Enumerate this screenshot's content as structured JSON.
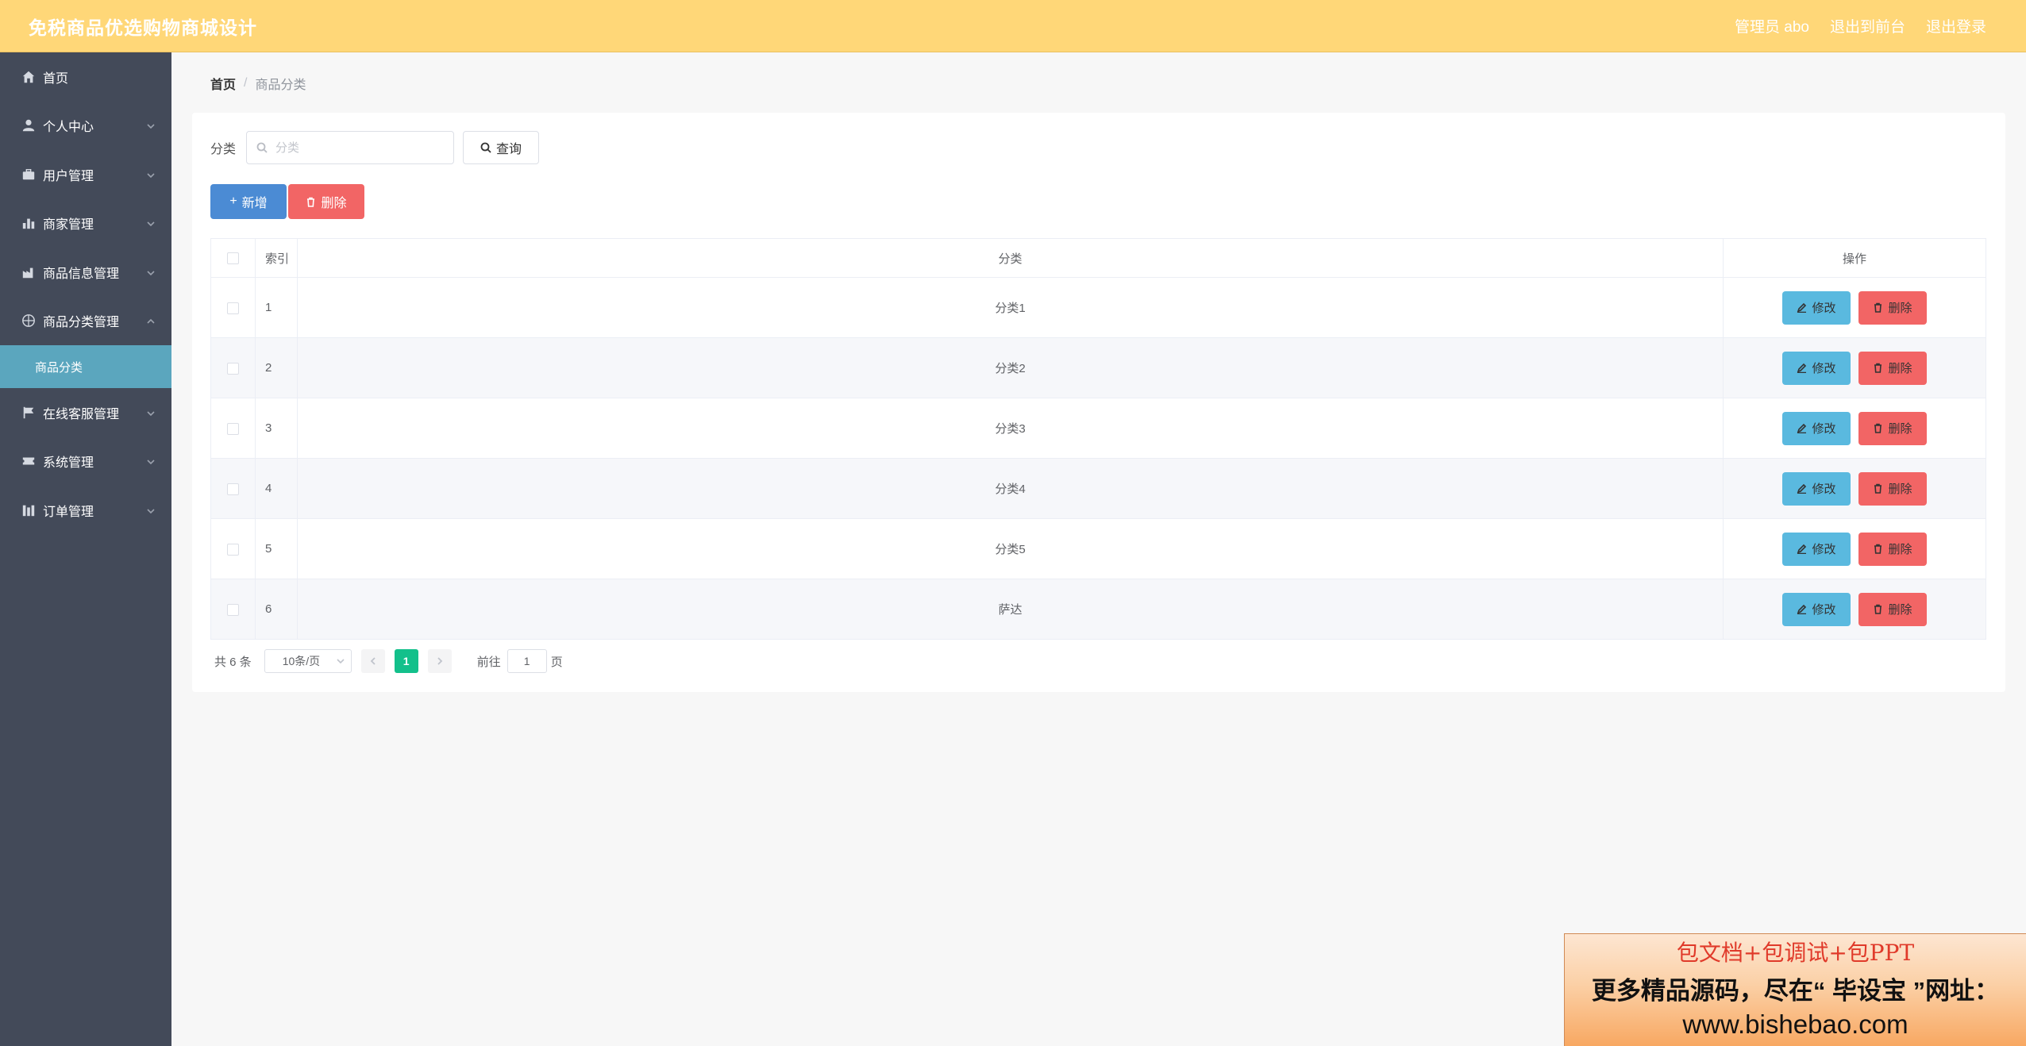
{
  "app": {
    "title": "免税商品优选购物商城设计"
  },
  "header": {
    "user_label": "管理员 abo",
    "back_label": "退出到前台",
    "logout_label": "退出登录"
  },
  "sidebar": {
    "items": [
      {
        "label": "首页",
        "icon": "home-icon"
      },
      {
        "label": "个人中心",
        "icon": "user-icon"
      },
      {
        "label": "用户管理",
        "icon": "briefcase-icon"
      },
      {
        "label": "商家管理",
        "icon": "bar-chart-icon"
      },
      {
        "label": "商品信息管理",
        "icon": "factory-icon"
      },
      {
        "label": "商品分类管理",
        "icon": "aperture-icon"
      },
      {
        "label": "在线客服管理",
        "icon": "flag-icon"
      },
      {
        "label": "系统管理",
        "icon": "ticket-icon"
      },
      {
        "label": "订单管理",
        "icon": "building-icon"
      }
    ],
    "active_sub": "商品分类"
  },
  "breadcrumb": {
    "home": "首页",
    "separator": "/",
    "current": "商品分类"
  },
  "search": {
    "label": "分类",
    "placeholder": "分类",
    "query_label": "查询"
  },
  "actions": {
    "add_label": "新增",
    "delete_label": "删除"
  },
  "table": {
    "headers": {
      "index": "索引",
      "category": "分类",
      "operation": "操作"
    },
    "edit_label": "修改",
    "delete_label": "删除",
    "rows": [
      {
        "index": "1",
        "category": "分类1"
      },
      {
        "index": "2",
        "category": "分类2"
      },
      {
        "index": "3",
        "category": "分类3"
      },
      {
        "index": "4",
        "category": "分类4"
      },
      {
        "index": "5",
        "category": "分类5"
      },
      {
        "index": "6",
        "category": "萨达"
      }
    ]
  },
  "pagination": {
    "total": "共 6 条",
    "page_size": "10条/页",
    "current_page": "1",
    "goto_label": "前往",
    "goto_value": "1",
    "page_suffix": "页"
  },
  "promo": {
    "line1": "包文档+包调试+包PPT",
    "line2": "更多精品源码，尽在“ 毕设宝 ”网址：",
    "line3": "www.bishebao.com"
  },
  "colors": {
    "header": "#ffd778",
    "sidebar": "#434a59",
    "active_sub": "#5ba6be",
    "primary": "#4b8bd4",
    "danger": "#f26565",
    "edit": "#5ab9df",
    "page_active": "#13c08b"
  }
}
